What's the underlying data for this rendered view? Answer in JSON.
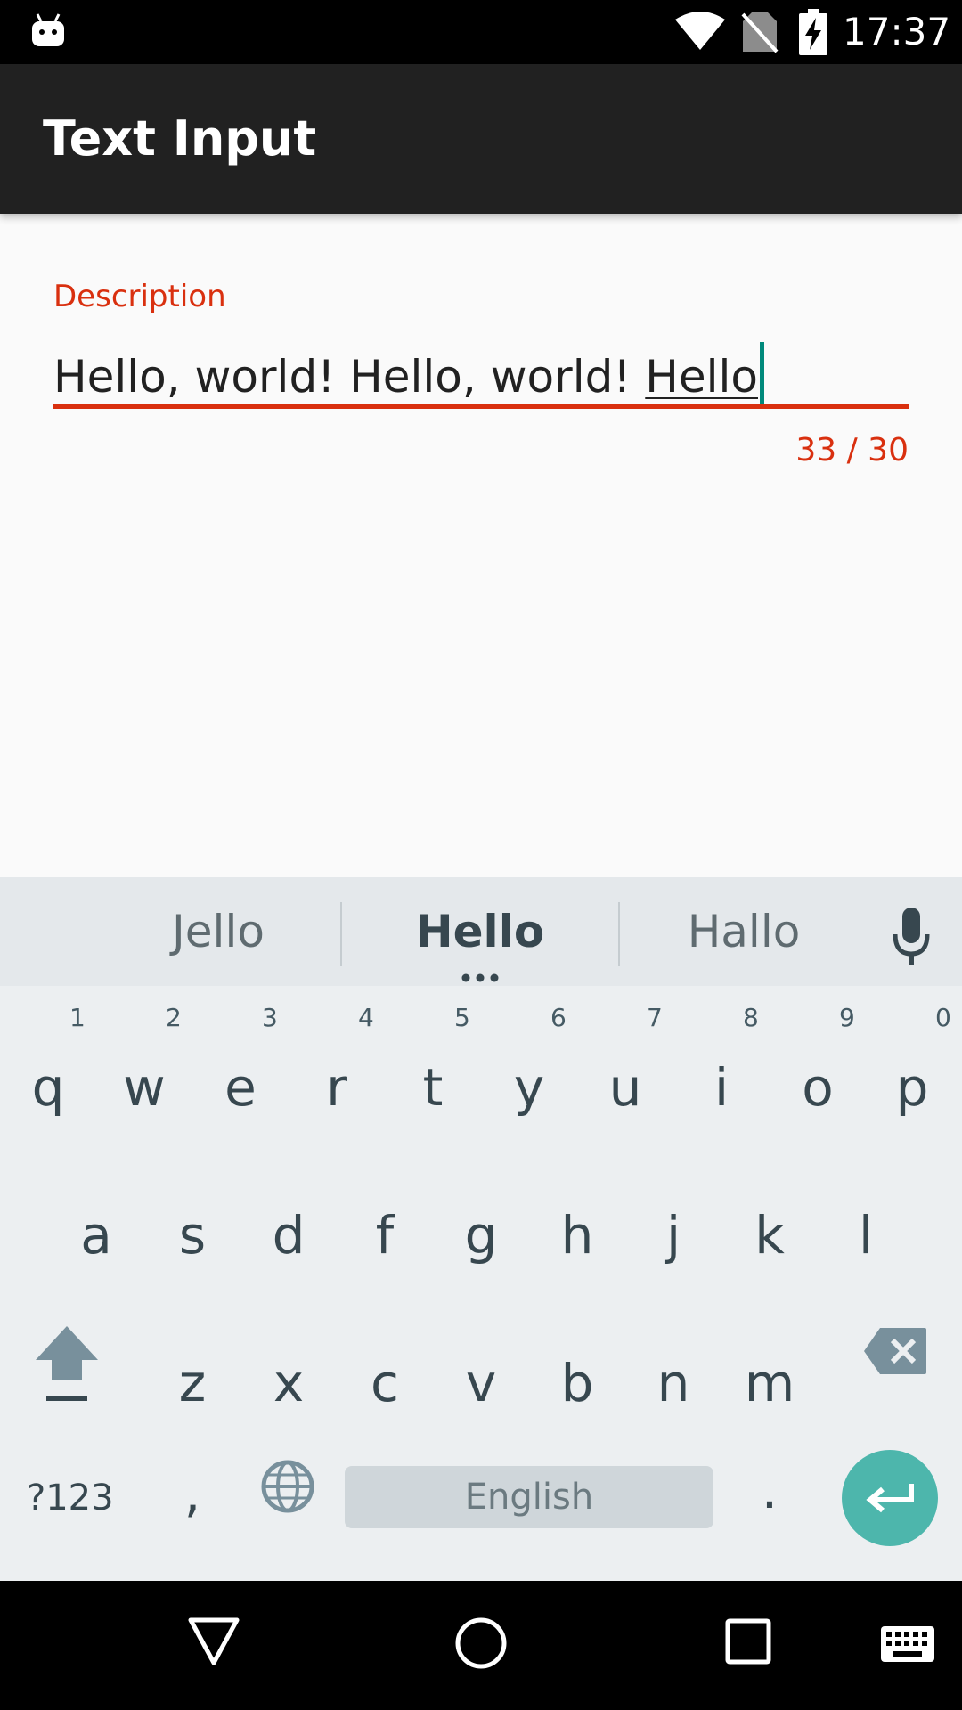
{
  "status_bar": {
    "time": "17:37",
    "icons": [
      "android-icon",
      "wifi-icon",
      "no-sim-icon",
      "battery-charging-icon"
    ]
  },
  "app_bar": {
    "title": "Text Input"
  },
  "form": {
    "description_label": "Description",
    "input_committed": "Hello, world! Hello, world! ",
    "input_composing": "Hello",
    "char_counter": "33 / 30",
    "error_color": "#d9300f",
    "cursor_color": "#00897b"
  },
  "keyboard": {
    "suggestions": [
      "Jello",
      "Hello",
      "Hallo"
    ],
    "row1": [
      {
        "letter": "q",
        "hint": "1"
      },
      {
        "letter": "w",
        "hint": "2"
      },
      {
        "letter": "e",
        "hint": "3"
      },
      {
        "letter": "r",
        "hint": "4"
      },
      {
        "letter": "t",
        "hint": "5"
      },
      {
        "letter": "y",
        "hint": "6"
      },
      {
        "letter": "u",
        "hint": "7"
      },
      {
        "letter": "i",
        "hint": "8"
      },
      {
        "letter": "o",
        "hint": "9"
      },
      {
        "letter": "p",
        "hint": "0"
      }
    ],
    "row2": [
      "a",
      "s",
      "d",
      "f",
      "g",
      "h",
      "j",
      "k",
      "l"
    ],
    "row3": [
      "z",
      "x",
      "c",
      "v",
      "b",
      "n",
      "m"
    ],
    "symbols_label": "?123",
    "comma": ",",
    "space_label": "English",
    "period": ".",
    "enter_color": "#4db6ac"
  },
  "nav_bar": {
    "icons": [
      "back-icon",
      "home-icon",
      "recents-icon",
      "keyboard-switch-icon"
    ]
  }
}
